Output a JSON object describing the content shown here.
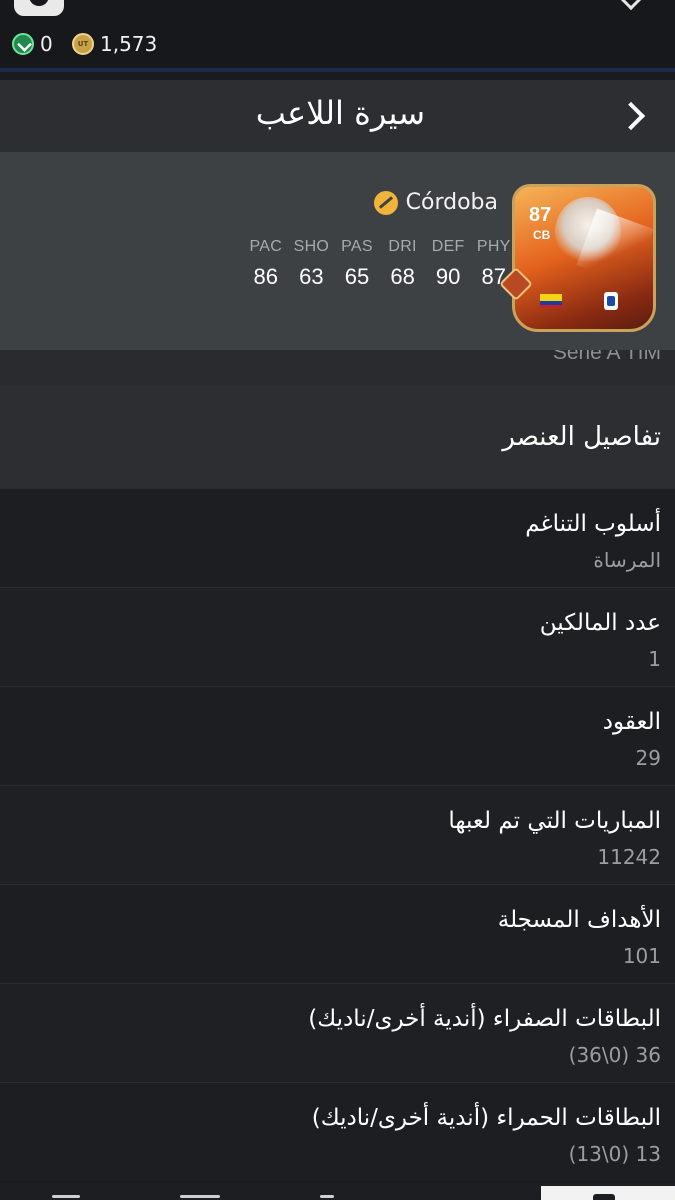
{
  "status": {
    "points": "0",
    "coins": "1,573"
  },
  "header": {
    "title": "سيرة اللاعب"
  },
  "player": {
    "club": "Córdoba",
    "rating": "87",
    "position": "CB",
    "league_text": "Serie A TIM",
    "stats": [
      {
        "label": "PAC",
        "value": "86"
      },
      {
        "label": "SHO",
        "value": "63"
      },
      {
        "label": "PAS",
        "value": "65"
      },
      {
        "label": "DRI",
        "value": "68"
      },
      {
        "label": "DEF",
        "value": "90"
      },
      {
        "label": "PHY",
        "value": "87"
      }
    ]
  },
  "section": {
    "title": "تفاصيل العنصر"
  },
  "details": [
    {
      "label": "أسلوب التناغم",
      "value": "المرساة"
    },
    {
      "label": "عدد المالكين",
      "value": "1"
    },
    {
      "label": "العقود",
      "value": "29"
    },
    {
      "label": "المباريات التي تم لعبها",
      "value": "11242"
    },
    {
      "label": "الأهداف المسجلة",
      "value": "101"
    },
    {
      "label": "البطاقات الصفراء (أندية أخرى/ناديك)",
      "value": "36 (0\\36)"
    },
    {
      "label": "البطاقات الحمراء (أندية أخرى/ناديك)",
      "value": "13 (0\\13)"
    }
  ],
  "colors": {
    "background": "#1a1b1e",
    "header": "#2d2e31",
    "card_panel": "#3e4144",
    "club_icon": "#f0b43a",
    "points_icon": "#1f8a4c",
    "coin_icon": "#c8a14a"
  },
  "icons": {
    "points": "fc-points-icon",
    "coins": "coin-icon",
    "back": "chevron-right-icon",
    "club": "club-crest-icon"
  }
}
